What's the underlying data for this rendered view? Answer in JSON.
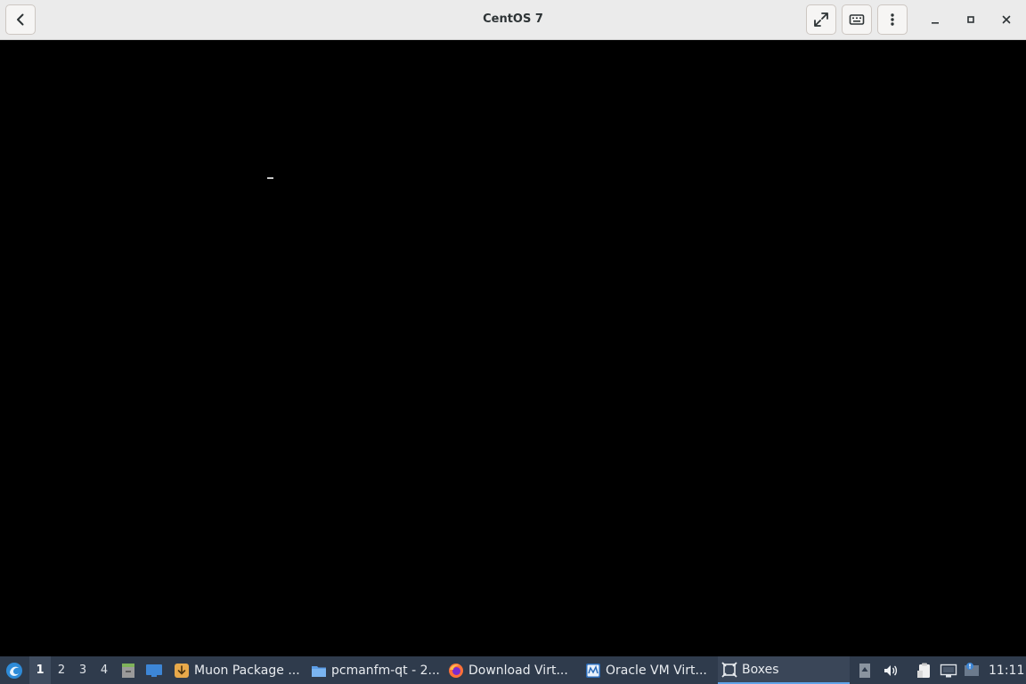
{
  "window": {
    "title": "CentOS 7",
    "buttons": [
      "back",
      "fullscreen",
      "keyboard",
      "menu",
      "minimize",
      "maximize",
      "close"
    ]
  },
  "taskbar": {
    "desktops": [
      "1",
      "2",
      "3",
      "4"
    ],
    "active_desktop": "1",
    "tasks": [
      {
        "label": "Muon Package ...",
        "icon": "package-icon"
      },
      {
        "label": "pcmanfm-qt - 2...",
        "icon": "folder-icon"
      },
      {
        "label": "Download Virt...",
        "icon": "firefox-icon"
      },
      {
        "label": "Oracle VM Virt...",
        "icon": "virtualbox-icon"
      },
      {
        "label": "Boxes",
        "icon": "boxes-icon"
      }
    ],
    "active_task": "Boxes",
    "clock": "11:11"
  },
  "colors": {
    "headerbar": "#ebebeb",
    "taskbar": "#2f3b4c",
    "accent": "#5fa3e8"
  }
}
